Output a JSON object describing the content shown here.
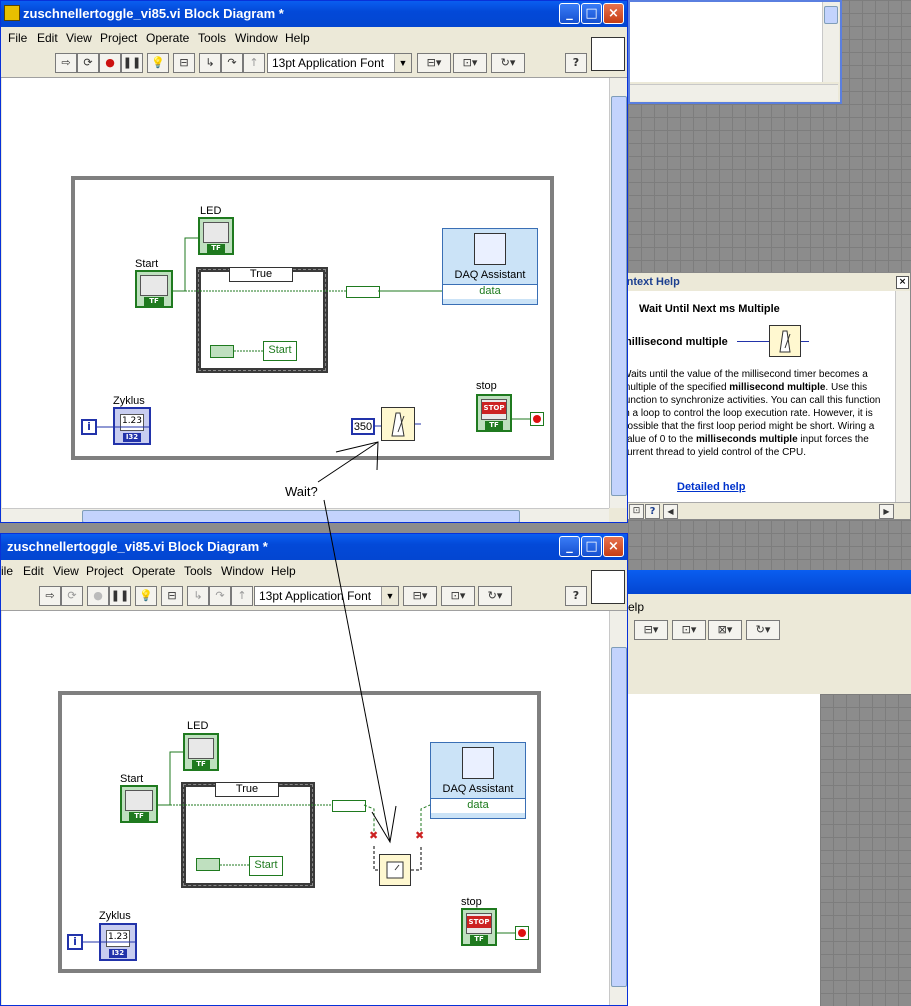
{
  "window_top": {
    "title": "zuschnellertoggle_vi85.vi Block Diagram *",
    "menu": [
      "File",
      "Edit",
      "View",
      "Project",
      "Operate",
      "Tools",
      "Window",
      "Help"
    ],
    "font_selector": "13pt Application Font"
  },
  "window_bottom": {
    "title": "zuschnellertoggle_vi85.vi Block Diagram *",
    "menu": [
      "ile",
      "Edit",
      "View",
      "Project",
      "Operate",
      "Tools",
      "Window",
      "Help"
    ],
    "font_selector": "13pt Application Font"
  },
  "diagram": {
    "led_label": "LED",
    "start_label": "Start",
    "case_selector": "True",
    "start_string": "Start",
    "daq_name": "DAQ Assistant",
    "daq_output": "data",
    "zyklus_label": "Zyklus",
    "zyklus_value": "1.23",
    "iteration": "i",
    "stop_label": "stop",
    "stop_button": "STOP",
    "wait_constant": "350",
    "bool_code": "TF",
    "num_code": "I32"
  },
  "annotation": {
    "text": "Wait?"
  },
  "context_help": {
    "title": "Context Help",
    "function_name": "Wait Until Next ms Multiple",
    "input_name": "millisecond multiple",
    "desc_1": "Waits until the value of the millisecond timer becomes a multiple of the specified ",
    "desc_bold_1": "millisecond multiple",
    "desc_2": ". Use this function to synchronize activities. You can call this function in a loop to control the loop execution rate. However, it is possible that the first loop period might be short. Wiring a value of 0 to the ",
    "desc_bold_2": "milliseconds multiple",
    "desc_3": " input forces the current thread to yield control of the CPU.",
    "link": "Detailed help"
  },
  "right_window": {
    "menu_fragment": "elp"
  },
  "colors": {
    "titlebar": "#0349d8",
    "wire_boolean": "#1f7a1f",
    "wire_numeric": "#2233aa",
    "loop_border": "#7f7f7f"
  }
}
